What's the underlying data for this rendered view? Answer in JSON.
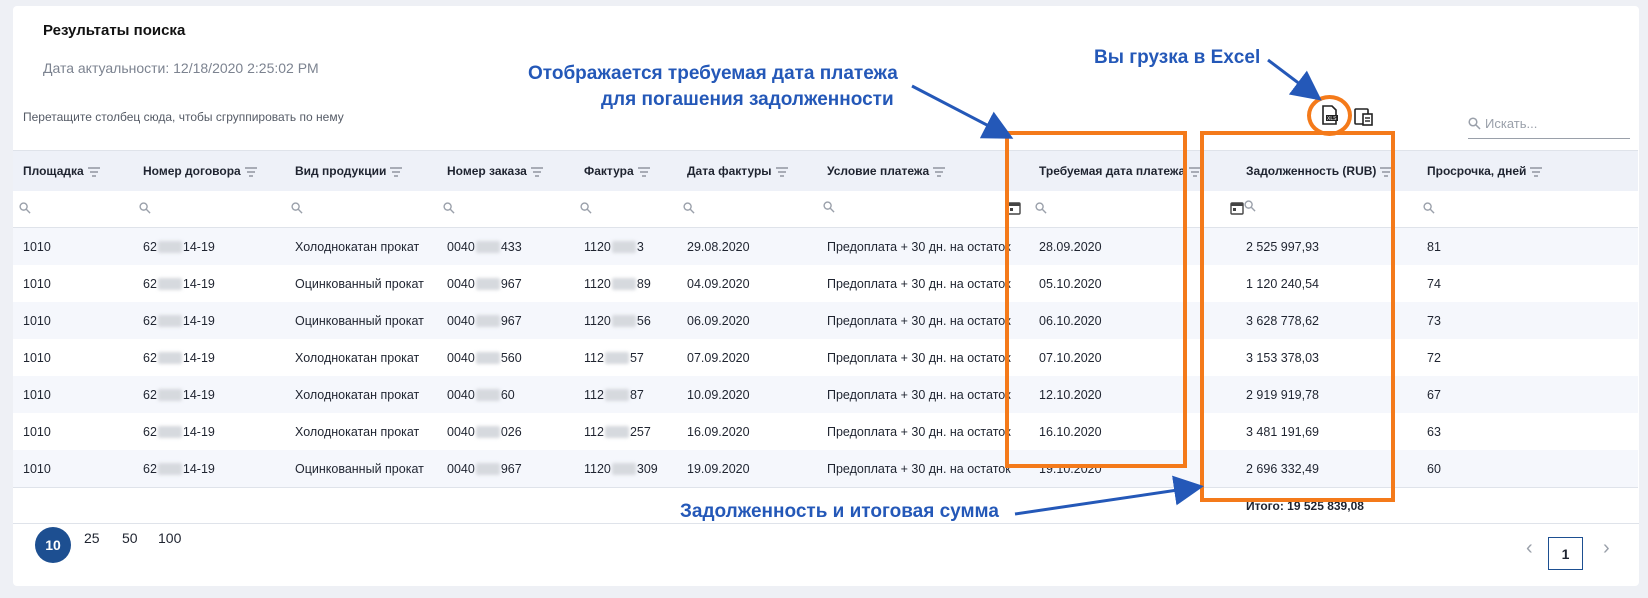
{
  "panel": {
    "title": "Результаты поиска",
    "actuality": "Дата актуальности: 12/18/2020 2:25:02 PM",
    "group_hint": "Перетащите столбец сюда, чтобы сгруппировать по нему",
    "search_placeholder": "Искать..."
  },
  "columns": [
    "Площадка",
    "Номер договора",
    "Вид продукции",
    "Номер заказа",
    "Фактура",
    "Дата фактуры",
    "Условие платежа",
    "Требуемая дата платежа",
    "Задолженность (RUB)",
    "Просрочка, дней"
  ],
  "rows": [
    {
      "site": "1010",
      "contract_a": "62",
      "contract_b": "14-19",
      "product": "Холоднокатан прокат",
      "order_a": "0040",
      "order_b": "433",
      "invoice_a": "1120",
      "invoice_b": "3",
      "invoice_date": "29.08.2020",
      "terms": "Предоплата + 30 дн. на остаток",
      "due_date": "28.09.2020",
      "debt": "2 525 997,93",
      "overdue": "81"
    },
    {
      "site": "1010",
      "contract_a": "62",
      "contract_b": "14-19",
      "product": "Оцинкованный прокат",
      "order_a": "0040",
      "order_b": "967",
      "invoice_a": "1120",
      "invoice_b": "89",
      "invoice_date": "04.09.2020",
      "terms": "Предоплата + 30 дн. на остаток",
      "due_date": "05.10.2020",
      "debt": "1 120 240,54",
      "overdue": "74"
    },
    {
      "site": "1010",
      "contract_a": "62",
      "contract_b": "14-19",
      "product": "Оцинкованный прокат",
      "order_a": "0040",
      "order_b": "967",
      "invoice_a": "1120",
      "invoice_b": "56",
      "invoice_date": "06.09.2020",
      "terms": "Предоплата + 30 дн. на остаток",
      "due_date": "06.10.2020",
      "debt": "3 628 778,62",
      "overdue": "73"
    },
    {
      "site": "1010",
      "contract_a": "62",
      "contract_b": "14-19",
      "product": "Холоднокатан прокат",
      "order_a": "0040",
      "order_b": "560",
      "invoice_a": "112",
      "invoice_b": "57",
      "invoice_date": "07.09.2020",
      "terms": "Предоплата + 30 дн. на остаток",
      "due_date": "07.10.2020",
      "debt": "3 153 378,03",
      "overdue": "72"
    },
    {
      "site": "1010",
      "contract_a": "62",
      "contract_b": "14-19",
      "product": "Холоднокатан прокат",
      "order_a": "0040",
      "order_b": "60",
      "invoice_a": "112",
      "invoice_b": "87",
      "invoice_date": "10.09.2020",
      "terms": "Предоплата + 30 дн. на остаток",
      "due_date": "12.10.2020",
      "debt": "2 919 919,78",
      "overdue": "67"
    },
    {
      "site": "1010",
      "contract_a": "62",
      "contract_b": "14-19",
      "product": "Холоднокатан прокат",
      "order_a": "0040",
      "order_b": "026",
      "invoice_a": "112",
      "invoice_b": "257",
      "invoice_date": "16.09.2020",
      "terms": "Предоплата + 30 дн. на остаток",
      "due_date": "16.10.2020",
      "debt": "3 481 191,69",
      "overdue": "63"
    },
    {
      "site": "1010",
      "contract_a": "62",
      "contract_b": "14-19",
      "product": "Оцинкованный прокат",
      "order_a": "0040",
      "order_b": "967",
      "invoice_a": "1120",
      "invoice_b": "309",
      "invoice_date": "19.09.2020",
      "terms": "Предоплата + 30 дн. на остаток",
      "due_date": "19.10.2020",
      "debt": "2 696 332,49",
      "overdue": "60"
    }
  ],
  "total": "Итого: 19 525 839,08",
  "pagination": {
    "sizes": [
      "10",
      "25",
      "50",
      "100"
    ],
    "active_size": "10",
    "current_page": "1"
  },
  "annotations": {
    "due_date_line1": "Отображается требуемая дата платежа",
    "due_date_line2": "для погашения задолженности",
    "excel": "Вы грузка в Excel",
    "debt_total": "Задолженность и итоговая сумма"
  },
  "colors": {
    "accent": "#1d4f91",
    "highlight": "#f47a1a",
    "annotation_text": "#2458b8",
    "header_bg": "#eef1f8"
  },
  "icons": [
    "excel-export-icon",
    "column-chooser-icon",
    "search-icon",
    "filter-icon",
    "calendar-icon",
    "chevron-left-icon",
    "chevron-right-icon"
  ]
}
